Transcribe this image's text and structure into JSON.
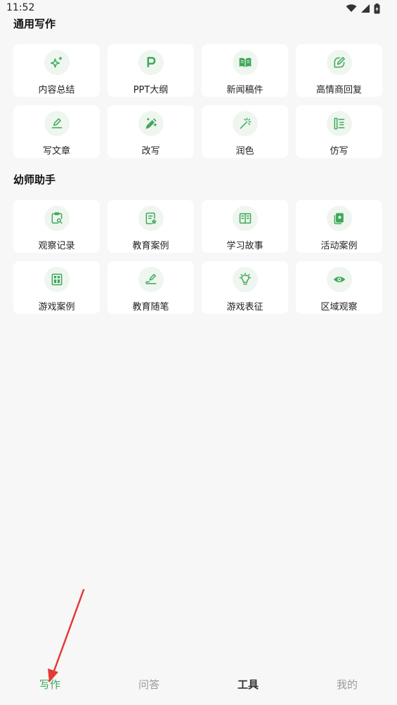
{
  "status_bar": {
    "time": "11:52",
    "icons": [
      "wifi-icon",
      "signal-icon",
      "battery-icon"
    ]
  },
  "colors": {
    "accent": "#3fa85a",
    "icon_bg": "#eef6ef",
    "card_bg": "#ffffff",
    "page_bg": "#f7f7f7",
    "annotation_arrow": "#e53935"
  },
  "sections": [
    {
      "title": "通用写作",
      "items": [
        {
          "label": "内容总结",
          "icon": "sparkle-icon"
        },
        {
          "label": "PPT大纲",
          "icon": "p-letter-icon"
        },
        {
          "label": "新闻稿件",
          "icon": "open-book-icon"
        },
        {
          "label": "高情商回复",
          "icon": "edit-note-icon"
        },
        {
          "label": "写文章",
          "icon": "pen-line-icon"
        },
        {
          "label": "改写",
          "icon": "magic-pencil-icon"
        },
        {
          "label": "润色",
          "icon": "magic-wand-icon"
        },
        {
          "label": "仿写",
          "icon": "list-lines-icon"
        }
      ]
    },
    {
      "title": "幼师助手",
      "items": [
        {
          "label": "观察记录",
          "icon": "clipboard-search-icon"
        },
        {
          "label": "教育案例",
          "icon": "document-star-icon"
        },
        {
          "label": "学习故事",
          "icon": "book-icon"
        },
        {
          "label": "活动案例",
          "icon": "star-card-icon"
        },
        {
          "label": "游戏案例",
          "icon": "grid-board-icon"
        },
        {
          "label": "教育随笔",
          "icon": "pen-sign-icon"
        },
        {
          "label": "游戏表征",
          "icon": "lightbulb-icon"
        },
        {
          "label": "区域观察",
          "icon": "eye-icon"
        }
      ]
    }
  ],
  "tabs": [
    {
      "label": "写作",
      "state": "active"
    },
    {
      "label": "问答",
      "state": "inactive"
    },
    {
      "label": "工具",
      "state": "bold"
    },
    {
      "label": "我的",
      "state": "inactive"
    }
  ]
}
